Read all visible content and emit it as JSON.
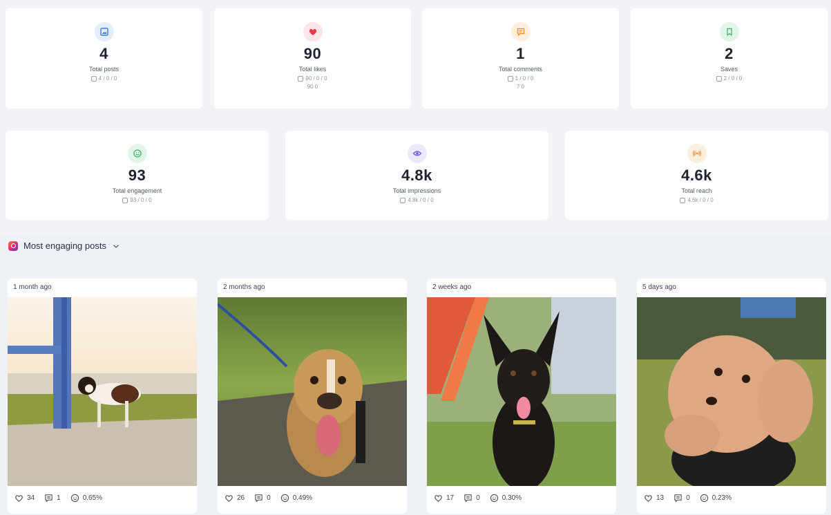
{
  "stats_row1": [
    {
      "value": "4",
      "label": "Total posts",
      "breakdown": "4 / 0 / 0",
      "breakdown2": "",
      "icon": "image-icon",
      "color": "#3b7bd6",
      "bg": "#e3edfb"
    },
    {
      "value": "90",
      "label": "Total likes",
      "breakdown": "90 / 0 / 0",
      "breakdown2": "90  0",
      "icon": "heart-icon",
      "color": "#e53946",
      "bg": "#fde4e6"
    },
    {
      "value": "1",
      "label": "Total comments",
      "breakdown": "1 / 0 / 0",
      "breakdown2": "7  0",
      "icon": "comment-icon",
      "color": "#f08a24",
      "bg": "#fdeedd"
    },
    {
      "value": "2",
      "label": "Saves",
      "breakdown": "2 / 0 / 0",
      "breakdown2": "",
      "icon": "bookmark-icon",
      "color": "#3bb36a",
      "bg": "#e2f5e9"
    }
  ],
  "stats_row2": [
    {
      "value": "93",
      "label": "Total engagement",
      "breakdown": "93 / 0 / 0",
      "icon": "smile-icon",
      "color": "#3bb36a",
      "bg": "#e2f5e9"
    },
    {
      "value": "4.8k",
      "label": "Total impressions",
      "breakdown": "4.8k / 0 / 0",
      "icon": "eye-icon",
      "color": "#6c5ce7",
      "bg": "#ebe8fc"
    },
    {
      "value": "4.6k",
      "label": "Total reach",
      "breakdown": "4.6k / 0 / 0",
      "icon": "broadcast-icon",
      "color": "#f08a24",
      "bg": "#fdeedd"
    }
  ],
  "section": {
    "title": "Most engaging posts"
  },
  "posts": [
    {
      "time": "1 month ago",
      "likes": "34",
      "comments": "1",
      "engagement": "0.65%",
      "image": "dog-at-sunset-by-blue-bench"
    },
    {
      "time": "2 months ago",
      "likes": "26",
      "comments": "0",
      "engagement": "0.49%",
      "image": "tan-dog-on-leash-walking"
    },
    {
      "time": "2 weeks ago",
      "likes": "17",
      "comments": "0",
      "engagement": "0.30%",
      "image": "black-dog-with-tongue-out"
    },
    {
      "time": "5 days ago",
      "likes": "13",
      "comments": "0",
      "engagement": "0.23%",
      "image": "apricot-poodle-on-grass"
    }
  ]
}
